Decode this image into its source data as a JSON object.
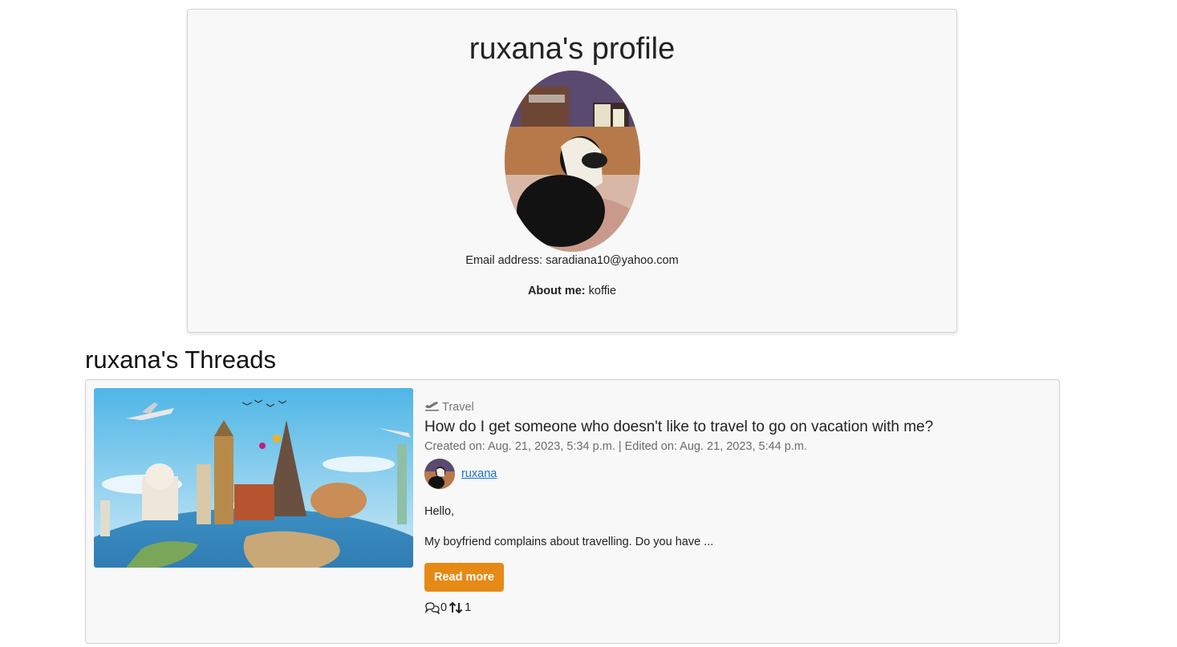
{
  "profile": {
    "title": "ruxana's profile",
    "email_label": "Email address:",
    "email": "saradiana10@yahoo.com",
    "about_label": "About me:",
    "about": "koffie"
  },
  "threads": {
    "heading": "ruxana's Threads",
    "items": [
      {
        "category": "Travel",
        "category_icon": "airplane-departure-icon",
        "title": "How do I get someone who doesn't like to travel to go on vacation with me?",
        "meta": "Created on: Aug. 21, 2023, 5:34 p.m. | Edited on: Aug. 21, 2023, 5:44 p.m.",
        "author": "ruxana",
        "excerpt_1": "Hello,",
        "excerpt_2": "My boyfriend complains about travelling. Do you have ...",
        "read_more": "Read more",
        "comments": "0",
        "votes": "1"
      }
    ]
  },
  "colors": {
    "accent": "#e68a16",
    "link": "#1a6fd1",
    "card_bg": "#f8f8f8"
  }
}
